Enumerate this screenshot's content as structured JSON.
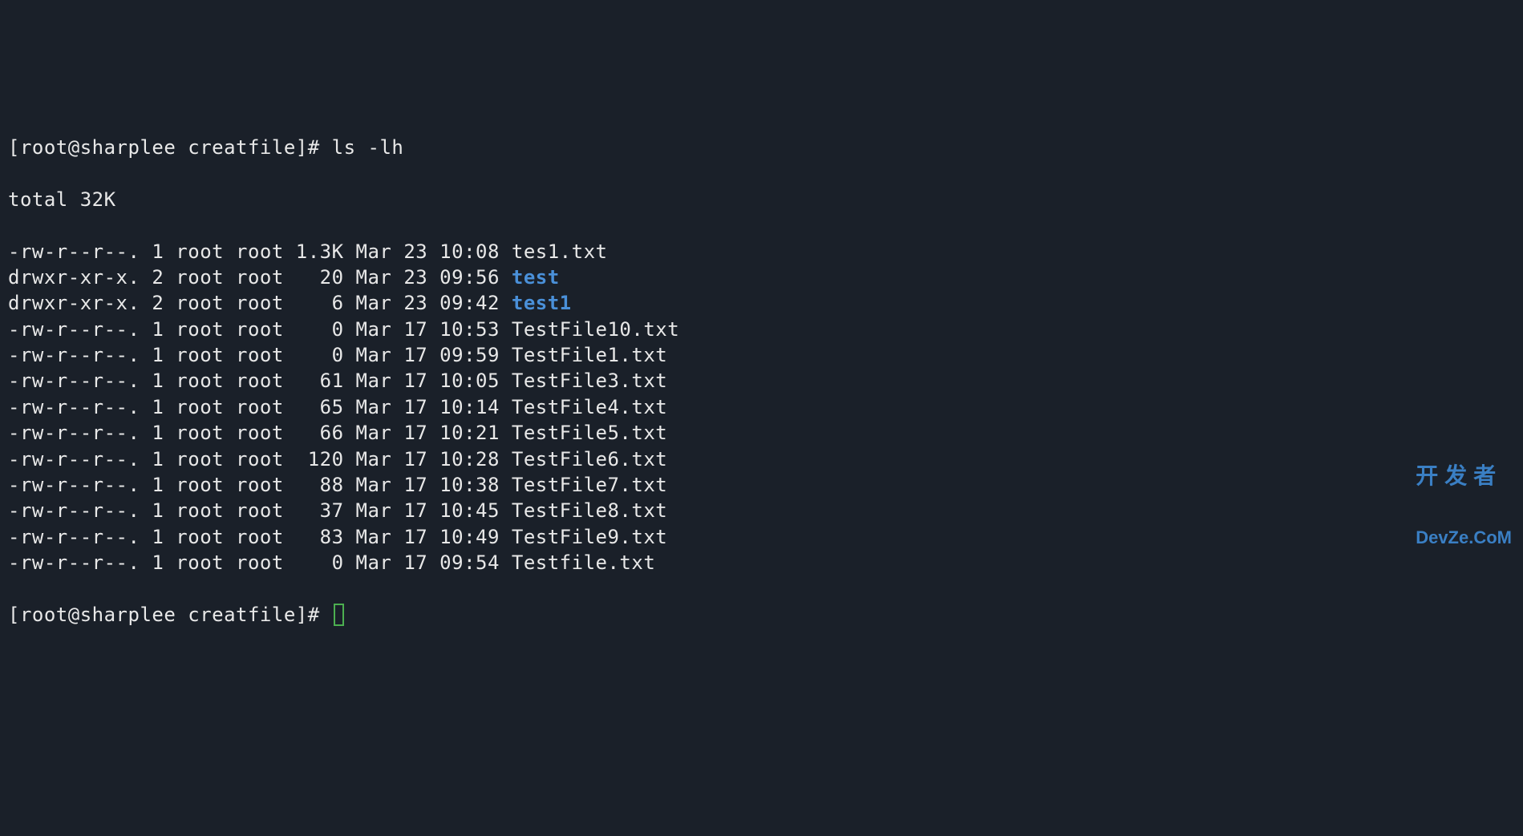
{
  "prompt1": "[root@sharplee creatfile]# ",
  "command": "ls -lh",
  "total_line": "total 32K",
  "files": [
    {
      "perms": "-rw-r--r--.",
      "links": "1",
      "owner": "root",
      "group": "root",
      "size": "1.3K",
      "month": "Mar",
      "day": "23",
      "time": "10:08",
      "name": "tes1.txt",
      "is_dir": false
    },
    {
      "perms": "drwxr-xr-x.",
      "links": "2",
      "owner": "root",
      "group": "root",
      "size": "  20",
      "month": "Mar",
      "day": "23",
      "time": "09:56",
      "name": "test",
      "is_dir": true
    },
    {
      "perms": "drwxr-xr-x.",
      "links": "2",
      "owner": "root",
      "group": "root",
      "size": "   6",
      "month": "Mar",
      "day": "23",
      "time": "09:42",
      "name": "test1",
      "is_dir": true
    },
    {
      "perms": "-rw-r--r--.",
      "links": "1",
      "owner": "root",
      "group": "root",
      "size": "   0",
      "month": "Mar",
      "day": "17",
      "time": "10:53",
      "name": "TestFile10.txt",
      "is_dir": false
    },
    {
      "perms": "-rw-r--r--.",
      "links": "1",
      "owner": "root",
      "group": "root",
      "size": "   0",
      "month": "Mar",
      "day": "17",
      "time": "09:59",
      "name": "TestFile1.txt",
      "is_dir": false
    },
    {
      "perms": "-rw-r--r--.",
      "links": "1",
      "owner": "root",
      "group": "root",
      "size": "  61",
      "month": "Mar",
      "day": "17",
      "time": "10:05",
      "name": "TestFile3.txt",
      "is_dir": false
    },
    {
      "perms": "-rw-r--r--.",
      "links": "1",
      "owner": "root",
      "group": "root",
      "size": "  65",
      "month": "Mar",
      "day": "17",
      "time": "10:14",
      "name": "TestFile4.txt",
      "is_dir": false
    },
    {
      "perms": "-rw-r--r--.",
      "links": "1",
      "owner": "root",
      "group": "root",
      "size": "  66",
      "month": "Mar",
      "day": "17",
      "time": "10:21",
      "name": "TestFile5.txt",
      "is_dir": false
    },
    {
      "perms": "-rw-r--r--.",
      "links": "1",
      "owner": "root",
      "group": "root",
      "size": " 120",
      "month": "Mar",
      "day": "17",
      "time": "10:28",
      "name": "TestFile6.txt",
      "is_dir": false
    },
    {
      "perms": "-rw-r--r--.",
      "links": "1",
      "owner": "root",
      "group": "root",
      "size": "  88",
      "month": "Mar",
      "day": "17",
      "time": "10:38",
      "name": "TestFile7.txt",
      "is_dir": false
    },
    {
      "perms": "-rw-r--r--.",
      "links": "1",
      "owner": "root",
      "group": "root",
      "size": "  37",
      "month": "Mar",
      "day": "17",
      "time": "10:45",
      "name": "TestFile8.txt",
      "is_dir": false
    },
    {
      "perms": "-rw-r--r--.",
      "links": "1",
      "owner": "root",
      "group": "root",
      "size": "  83",
      "month": "Mar",
      "day": "17",
      "time": "10:49",
      "name": "TestFile9.txt",
      "is_dir": false
    },
    {
      "perms": "-rw-r--r--.",
      "links": "1",
      "owner": "root",
      "group": "root",
      "size": "   0",
      "month": "Mar",
      "day": "17",
      "time": "09:54",
      "name": "Testfile.txt",
      "is_dir": false
    }
  ],
  "prompt2": "[root@sharplee creatfile]# ",
  "watermark": {
    "line1": "开发者",
    "line2": "DevZe.CoM"
  }
}
